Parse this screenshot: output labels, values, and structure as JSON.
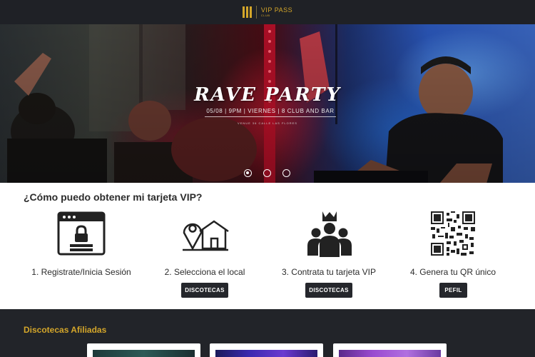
{
  "header": {
    "brand": "VIP PASS",
    "brand_sub": "CLUB"
  },
  "hero": {
    "title": "RAVE PARTY",
    "subtitle": "05/08 | 9PM | VIERNES | 8 CLUB AND BAR",
    "venue": "VENUE 36 CALLE LAS FLORES",
    "slides": 3,
    "active_slide": 1
  },
  "vip": {
    "title": "¿Cómo puedo obtener mi tarjeta VIP?",
    "steps": [
      {
        "label": "1. Registrate/Inicia Sesión",
        "icon": "login-browser-lock-icon"
      },
      {
        "label": "2. Selecciona el local",
        "icon": "map-pin-house-icon",
        "button": "DISCOTECAS"
      },
      {
        "label": "3. Contrata tu tarjeta VIP",
        "icon": "crown-group-icon",
        "button": "DISCOTECAS"
      },
      {
        "label": "4. Genera tu QR único",
        "icon": "qr-code-icon",
        "button": "PEFIL"
      }
    ]
  },
  "affiliated": {
    "title": "Discotecas Afiliadas"
  },
  "colors": {
    "accent": "#d4a62a",
    "dark": "#222429",
    "button": "#25272c"
  }
}
